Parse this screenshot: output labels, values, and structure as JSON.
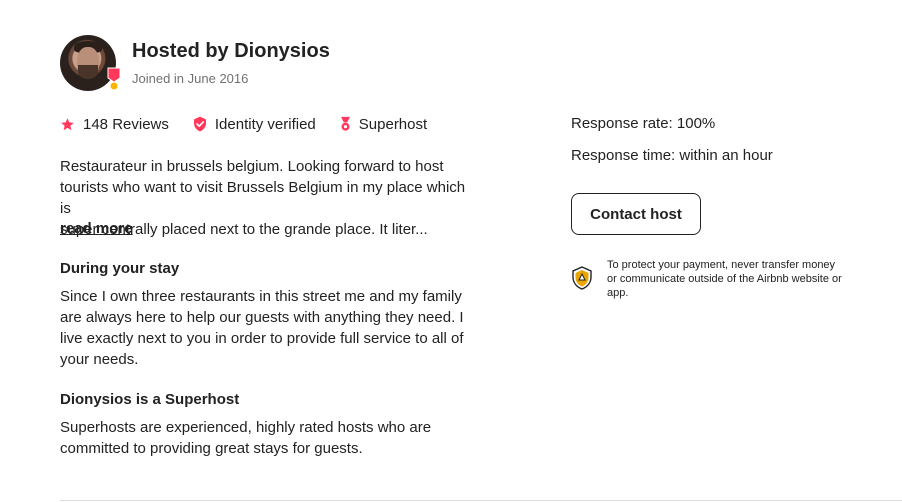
{
  "host": {
    "title": "Hosted by Dionysios",
    "joined": "Joined in June 2016"
  },
  "stats": {
    "reviews": "148 Reviews",
    "identity": "Identity verified",
    "superhost": "Superhost"
  },
  "description": {
    "line1": "Restaurateur in brussels belgium. Looking forward to host",
    "line2": "tourists who want to visit Brussels Belgium in my place which is",
    "line3": "super centrally placed next to the grande place. It liter...",
    "read_more": "read more"
  },
  "during_stay": {
    "title": "During your stay",
    "body": "Since I own three restaurants in this street me and my family are always here to help our guests with anything they need. I live exactly next to you in order to provide full service to all of your needs."
  },
  "superhost_section": {
    "title": "Dionysios is a Superhost",
    "body": "Superhosts are experienced, highly rated hosts who are committed to providing great stays for guests."
  },
  "response": {
    "rate": "Response rate: 100%",
    "time": "Response time: within an hour"
  },
  "contact_button": "Contact host",
  "protect_notice": "To protect your payment, never transfer money or communicate outside of the Airbnb website or app.",
  "colors": {
    "accent": "#ff385c",
    "text": "#222222",
    "muted": "#717171",
    "divider": "#dddddd",
    "shield_gold": "#e9a400"
  },
  "icons": {
    "reviews": "star-icon",
    "identity": "verified-shield-icon",
    "superhost": "superhost-medal-icon",
    "protect": "payment-protection-shield-icon"
  }
}
